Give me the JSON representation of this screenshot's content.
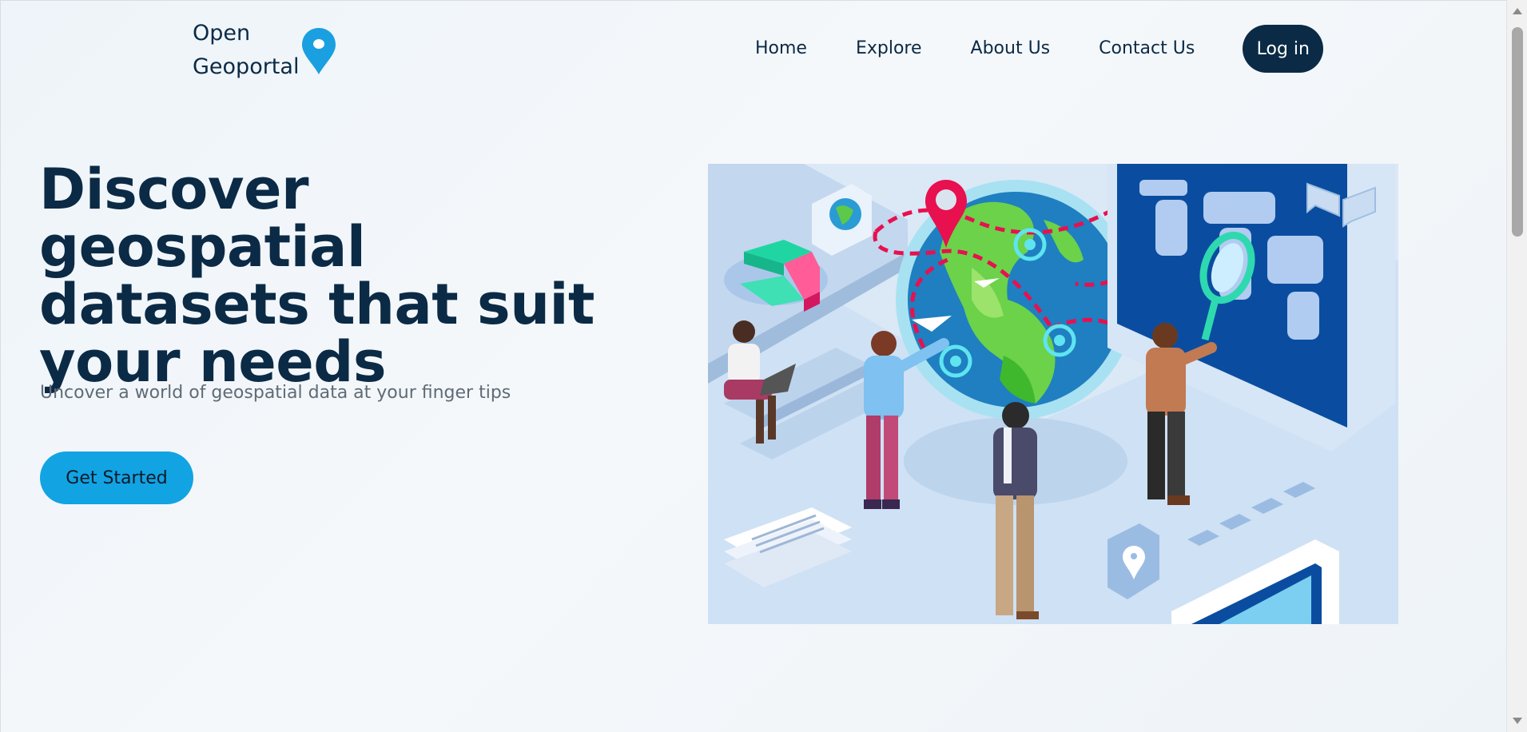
{
  "header": {
    "logo_line1": "Open",
    "logo_line2": "Geoportal",
    "nav": [
      "Home",
      "Explore",
      "About Us",
      "Contact Us"
    ],
    "login_label": "Log in"
  },
  "hero": {
    "title": "Discover geospatial datasets that suit your needs",
    "subtitle": "Uncover a world of geospatial data at your finger tips",
    "cta_label": "Get Started"
  },
  "colors": {
    "navy": "#0b2a45",
    "accent_blue": "#12a3e3",
    "pin_blue": "#1aa0e0",
    "magenta": "#e8104f"
  },
  "icons": {
    "logo_pin": "map-pin-icon"
  }
}
